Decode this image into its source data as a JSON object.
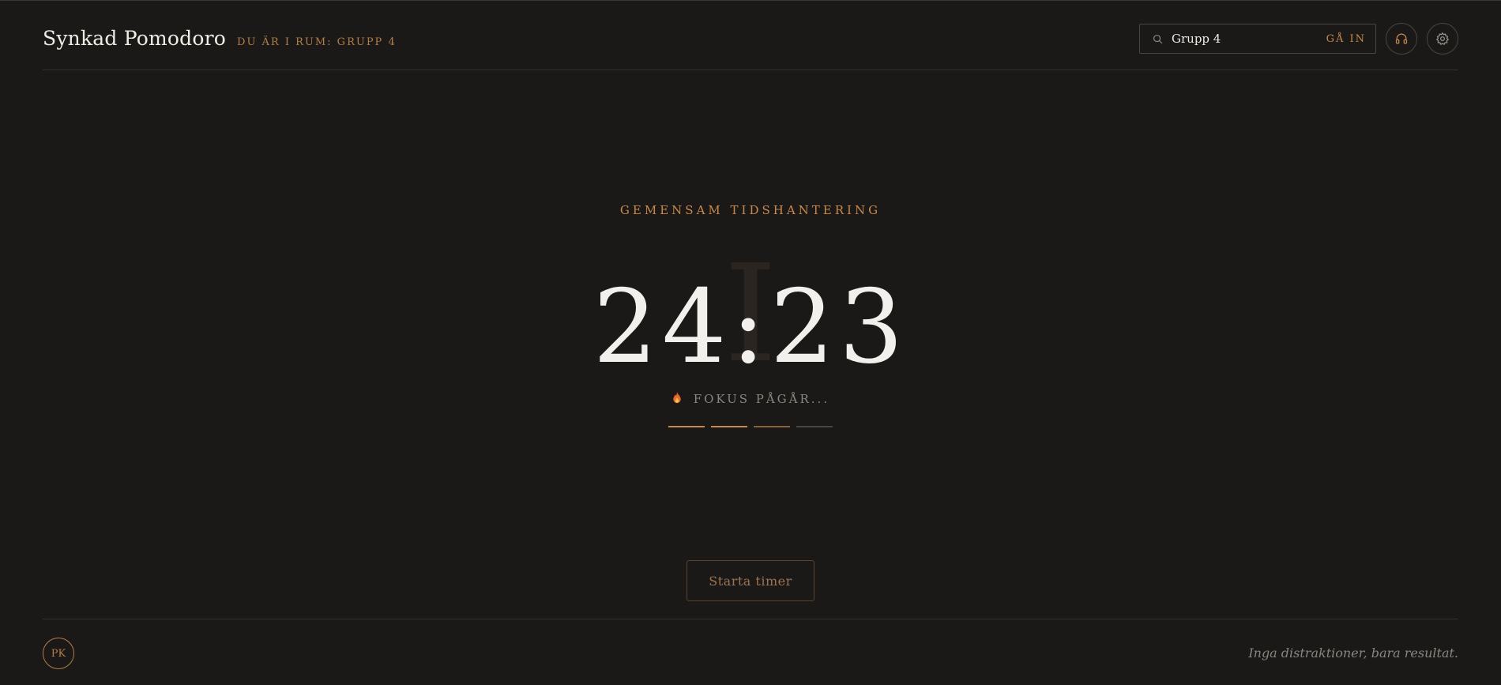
{
  "header": {
    "app_title": "Synkad Pomodoro",
    "room_label": "DU ÄR I RUM: GRUPP 4",
    "search": {
      "value": "Grupp 4",
      "placeholder": "",
      "icon": "search-icon"
    },
    "join_label": "GÅ IN",
    "icons": {
      "audio": "headphones-icon",
      "settings": "gear-icon"
    }
  },
  "main": {
    "kicker": "GEMENSAM TIDSHANTERING",
    "background_numeral": "I",
    "timer": "24:23",
    "status": "FOKUS PÅGÅR...",
    "status_icon": "fire-icon",
    "progress": {
      "total": 4,
      "completed": 2,
      "current": 3
    },
    "start_label": "Starta timer"
  },
  "footer": {
    "avatar_initials": "PK",
    "tagline": "Inga distraktioner, bara resultat."
  },
  "colors": {
    "background": "#1b1917",
    "accent": "#c8894d",
    "text": "#efebe5",
    "muted": "#8a8580"
  }
}
